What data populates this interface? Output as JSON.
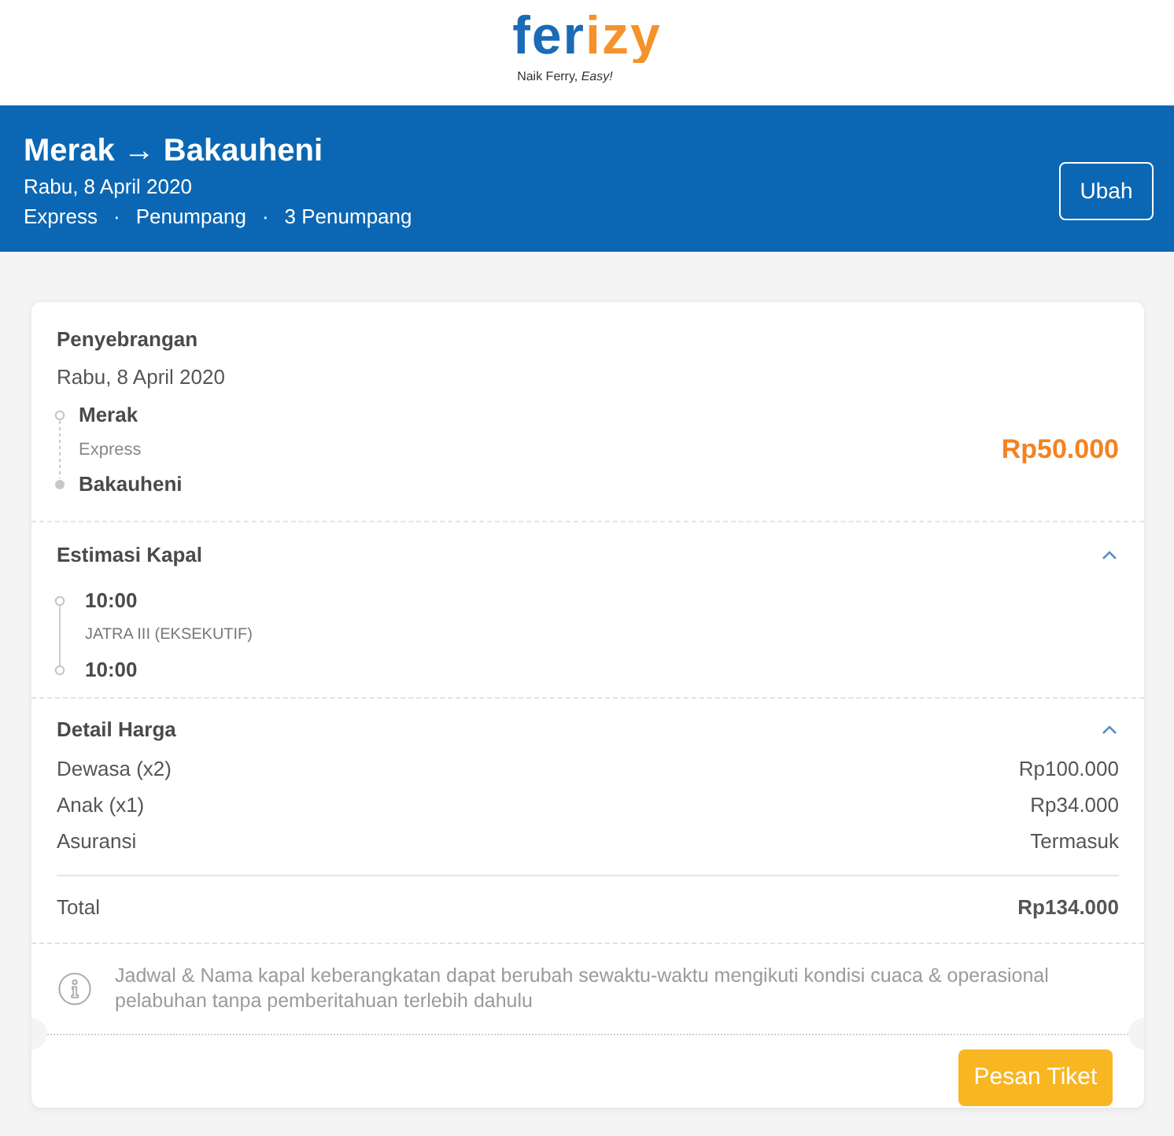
{
  "header": {
    "logo": "ferizy",
    "tagline": "Naik Ferry, *Easy!*"
  },
  "banner": {
    "title": "Merak → Bakauheni",
    "date": "Rabu, 8 April 2020",
    "details": [
      {
        "kind": "text",
        "text": "Express"
      },
      {
        "kind": "separator",
        "text": "·"
      },
      {
        "kind": "text",
        "text": "Penumpang"
      },
      {
        "kind": "separator",
        "text": "·"
      },
      {
        "kind": "text",
        "text": "3 Penumpang"
      }
    ],
    "edit_button": "Ubah"
  },
  "crossing": {
    "heading": "Penyebrangan",
    "date": "Rabu, 8 April 2020",
    "origin": "Merak",
    "service": "Express",
    "destination": "Bakauheni",
    "price": "Rp50.000"
  },
  "ship_estimate": {
    "heading": "Estimasi Kapal",
    "expanded": true,
    "departure": "10:00",
    "ship": "JATRA III (EKSEKUTIF)",
    "arrival": "10:00"
  },
  "price_detail": {
    "heading": "Detail Harga",
    "expanded": true,
    "rows": [
      {
        "label": "Dewasa (x2)",
        "value": "Rp100.000"
      },
      {
        "label": "Anak (x1)",
        "value": "Rp34.000"
      },
      {
        "label": "Asuransi",
        "value": "Termasuk"
      }
    ],
    "total": {
      "label": "Total",
      "value": "Rp134.000"
    }
  },
  "notice": "Jadwal & Nama kapal keberangkatan dapat berubah sewaktu-waktu mengikuti kondisi cuaca & operasional pelabuhan tanpa pemberitahuan terlebih dahulu",
  "book_button": "Pesan Tiket"
}
